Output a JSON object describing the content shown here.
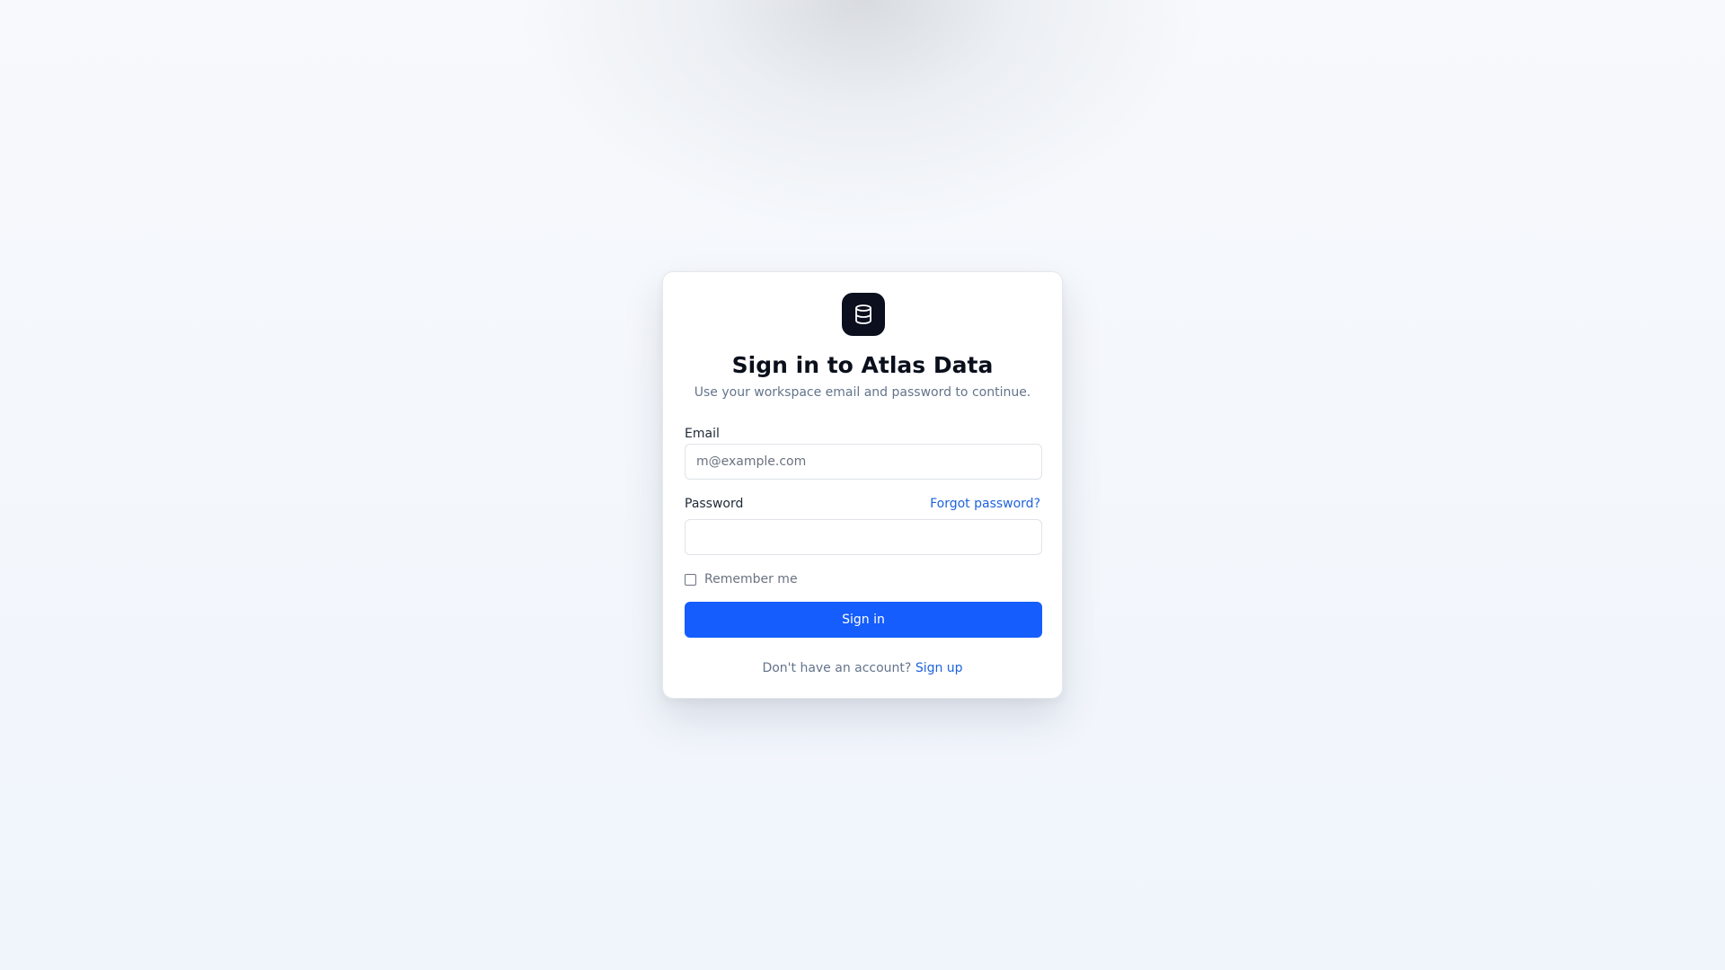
{
  "brand": {
    "icon": "database-icon",
    "icon_bg": "#0b0f1e"
  },
  "heading": {
    "title": "Sign in to Atlas Data",
    "subtitle": "Use your workspace email and password to continue."
  },
  "form": {
    "email_label": "Email",
    "email_placeholder": "m@example.com",
    "email_value": "",
    "password_label": "Password",
    "password_value": "",
    "forgot_label": "Forgot password?",
    "remember_label": "Remember me",
    "remember_checked": false,
    "submit_label": "Sign in"
  },
  "footer": {
    "prompt": "Don't have an account?",
    "signup_label": "Sign up"
  },
  "colors": {
    "primary": "#155dfc",
    "link": "#1d63dd"
  }
}
